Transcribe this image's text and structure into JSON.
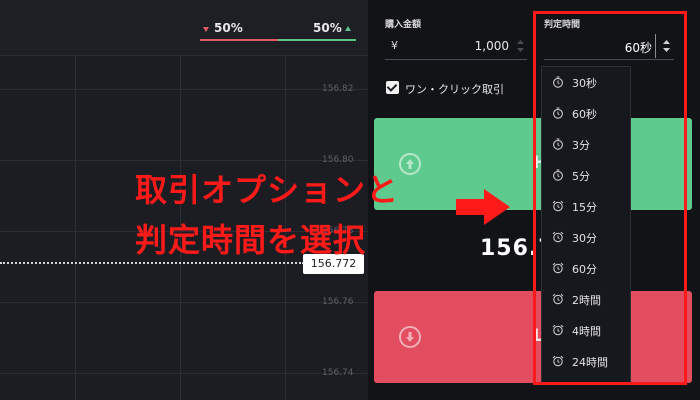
{
  "header": {
    "left_pct": "50%",
    "right_pct": "50%"
  },
  "axis": {
    "ticks": [
      "156.82",
      "156.80",
      "156.78",
      "156.76",
      "156.74"
    ]
  },
  "current_price": "156.772",
  "big_price_partial": "156.7",
  "overlay": {
    "line1": "取引オプションと",
    "line2": "判定時間を選択"
  },
  "purchase": {
    "label": "購入金額",
    "currency": "¥",
    "amount": "1,000"
  },
  "expiry": {
    "label": "判定時間",
    "value": "60秒"
  },
  "one_click": {
    "label": "ワン・クリック取引"
  },
  "buttons": {
    "high_partial": "H",
    "low_partial": "L"
  },
  "dropdown": {
    "options": [
      {
        "label": "30秒",
        "icon": "timer-icon"
      },
      {
        "label": "60秒",
        "icon": "timer-icon"
      },
      {
        "label": "3分",
        "icon": "timer-icon"
      },
      {
        "label": "5分",
        "icon": "timer-icon"
      },
      {
        "label": "15分",
        "icon": "alarm-clock-icon"
      },
      {
        "label": "30分",
        "icon": "alarm-clock-icon"
      },
      {
        "label": "60分",
        "icon": "alarm-clock-icon"
      },
      {
        "label": "2時間",
        "icon": "alarm-clock-icon"
      },
      {
        "label": "4時間",
        "icon": "alarm-clock-icon"
      },
      {
        "label": "24時間",
        "icon": "alarm-clock-icon"
      }
    ]
  },
  "colors": {
    "high": "#5fca8d",
    "low": "#e24d5f",
    "highlight": "#ff1a1a"
  }
}
